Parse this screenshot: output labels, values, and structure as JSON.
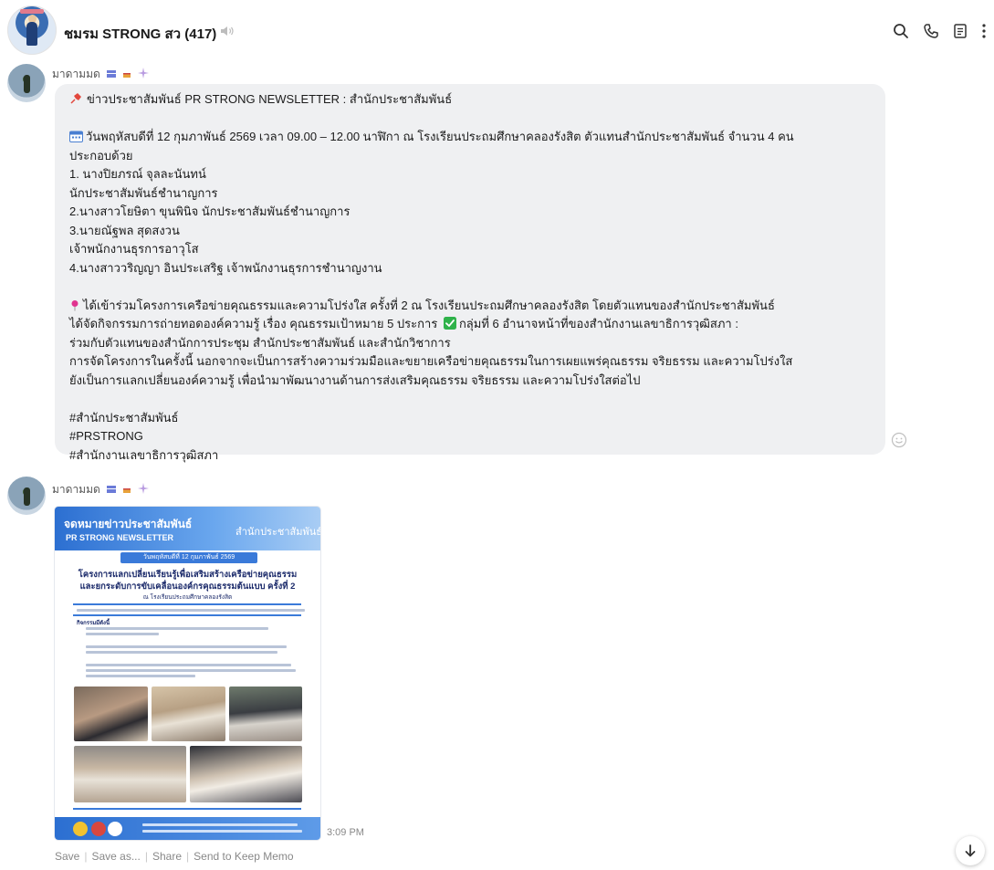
{
  "header": {
    "group_name": "ชมรม STRONG สว (417)",
    "icons": [
      "search-icon",
      "phone-icon",
      "notes-icon",
      "more-icon"
    ]
  },
  "messages": [
    {
      "sender": "มาดามมด",
      "lines": [
        "ข่าวประชาสัมพันธ์ PR STRONG NEWSLETTER : สำนักประชาสัมพันธ์",
        "",
        "วันพฤหัสบดีที่ 12 กุมภาพันธ์ 2569 เวลา 09.00 – 12.00 นาฬิกา ณ โรงเรียนประถมศึกษาคลองรังสิต ตัวแทนสำนักประชาสัมพันธ์ จำนวน 4 คน",
        "ประกอบด้วย",
        "1. นางปิยภรณ์ จุลละนันทน์",
        "นักประชาสัมพันธ์ชำนาญการ",
        "2.นางสาวโยษิตา ขุนพินิจ นักประชาสัมพันธ์ชำนาญการ",
        "3.นายณัฐพล สุดสงวน",
        "เจ้าพนักงานธุรการอาวุโส",
        "4.นางสาววริญญา อินประเสริฐ เจ้าพนักงานธุรการชำนาญงาน",
        "",
        "ได้เข้าร่วมโครงการเครือข่ายคุณธรรมและความโปร่งใส ครั้งที่ 2 ณ โรงเรียนประถมศึกษาคลองรังสิต โดยตัวแทนของสำนักประชาสัมพันธ์",
        "ได้จัดกิจกรรมการถ่ายทอดองค์ความรู้ เรื่อง คุณธรรมเป้าหมาย 5 ประการ",
        "ร่วมกับตัวแทนของสำนักการประชุม สำนักประชาสัมพันธ์ และสำนักวิชาการ",
        "การจัดโครงการในครั้งนี้ นอกจากจะเป็นการสร้างความร่วมมือและขยายเครือข่ายคุณธรรมในการเผยแพร่คุณธรรม จริยธรรม และความโปร่งใส",
        "ยังเป็นการแลกเปลี่ยนองค์ความรู้ เพื่อนำมาพัฒนางานด้านการส่งเสริมคุณธรรม จริยธรรม และความโปร่งใสต่อไป",
        "",
        "#สำนักประชาสัมพันธ์",
        "#PRSTRONG",
        "#สำนักงานเลขาธิการวุฒิสภา"
      ],
      "line12_suffix": "กลุ่มที่ 6 อำนาจหน้าที่ของสำนักงานเลขาธิการวุฒิสภา :"
    },
    {
      "sender": "มาดามมด",
      "poster": {
        "title": "จดหมายข่าวประชาสัมพันธ์",
        "subtitle": "PR STRONG NEWSLETTER",
        "org": "สำนักประชาสัมพันธ์",
        "date": "วันพฤหัสบดีที่ 12 กุมภาพันธ์ 2569",
        "headline1": "โครงการแลกเปลี่ยนเรียนรู้เพื่อเสริมสร้างเครือข่ายคุณธรรม",
        "headline2": "และยกระดับการขับเคลื่อนองค์กรคุณธรรมต้นแบบ ครั้งที่ 2",
        "location": "ณ โรงเรียนประถมศึกษาคลองรังสิต",
        "activities": "กิจกรรมมีดังนี้"
      },
      "time": "3:09 PM",
      "actions": [
        "Save",
        "Save as...",
        "Share",
        "Send to Keep Memo"
      ]
    }
  ],
  "colors": {
    "bubble": "#eff0f2",
    "poster_blue": "#2c6fd1",
    "check_green": "#2fb24a"
  }
}
